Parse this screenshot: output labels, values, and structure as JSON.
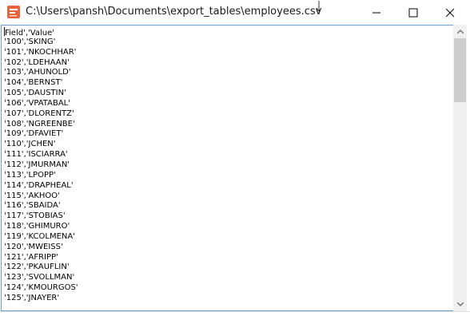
{
  "window": {
    "title": "C:\\Users\\pansh\\Documents\\export_tables\\employees.csv",
    "app_icon": "notepad-style-app-icon",
    "buttons": {
      "minimize": "minimize-icon",
      "maximize": "maximize-icon",
      "close": "close-icon"
    }
  },
  "editor": {
    "lines": [
      "Field','Value'",
      "'100','SKING'",
      "'101','NKOCHHAR'",
      "'102','LDEHAAN'",
      "'103','AHUNOLD'",
      "'104','BERNST'",
      "'105','DAUSTIN'",
      "'106','VPATABAL'",
      "'107','DLORENTZ'",
      "'108','NGREENBE'",
      "'109','DFAVIET'",
      "'110','JCHEN'",
      "'111','ISCIARRA'",
      "'112','JMURMAN'",
      "'113','LPOPP'",
      "'114','DRAPHEAL'",
      "'115','AKHOO'",
      "'116','SBAIDA'",
      "'117','STOBIAS'",
      "'118','GHIMURO'",
      "'119','KCOLMENA'",
      "'120','MWEISS'",
      "'121','AFRIPP'",
      "'122','PKAUFLIN'",
      "'123','SVOLLMAN'",
      "'124','KMOURGOS'",
      "'125','JNAYER'"
    ],
    "first_line_prefix": "'"
  },
  "scrollbar": {
    "position_fraction": 0.0
  },
  "colors": {
    "border": "#6e9ecf",
    "scroll_thumb": "#cdcdcd",
    "scroll_track": "#f0f0f0",
    "icon_orange": "#e8643c"
  }
}
